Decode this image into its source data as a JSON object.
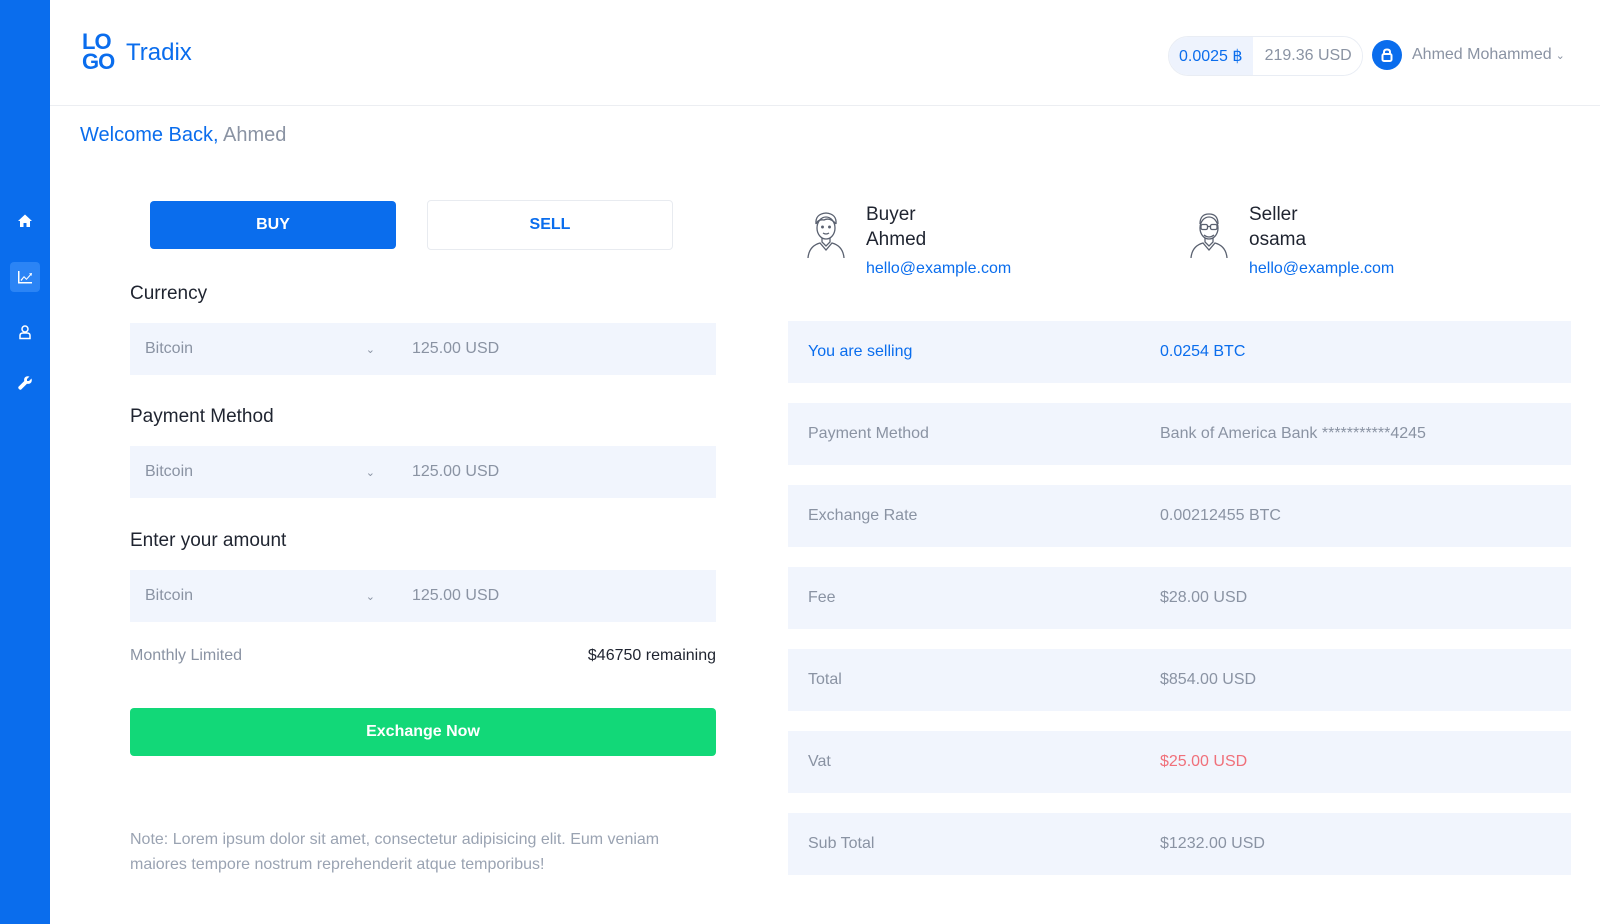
{
  "app": {
    "logo_mark_top": "LO",
    "logo_mark_bottom": "GO",
    "brand": "Tradix"
  },
  "header": {
    "btc_balance": "0.0025 ฿",
    "usd_balance": "219.36 USD",
    "user_name": "Ahmed Mohammed"
  },
  "sidebar": {
    "items": [
      {
        "icon": "home-icon"
      },
      {
        "icon": "chart-icon",
        "active": true
      },
      {
        "icon": "user-icon"
      },
      {
        "icon": "wrench-icon"
      }
    ]
  },
  "welcome": {
    "greeting": "Welcome Back, ",
    "name": "Ahmed"
  },
  "trade": {
    "buy_label": "BUY",
    "sell_label": "SELL",
    "fields": [
      {
        "label": "Currency",
        "select": "Bitcoin",
        "amount": "125.00 USD"
      },
      {
        "label": "Payment Method",
        "select": "Bitcoin",
        "amount": "125.00 USD"
      },
      {
        "label": "Enter your amount",
        "select": "Bitcoin",
        "amount": "125.00 USD"
      }
    ],
    "limit_label": "Monthly Limited",
    "limit_value": "$46750 remaining",
    "exchange_label": "Exchange Now",
    "note": "Note: Lorem ipsum dolor sit amet, consectetur adipisicing elit. Eum veniam maiores tempore nostrum reprehenderit atque temporibus!"
  },
  "buyer": {
    "role": "Buyer",
    "name": "Ahmed",
    "email": "hello@example.com"
  },
  "seller": {
    "role": "Seller",
    "name": "osama",
    "email": "hello@example.com"
  },
  "details": [
    {
      "key": "You are selling",
      "value": "0.0254 BTC"
    },
    {
      "key": "Payment Method",
      "value": "Bank of America Bank ***********4245"
    },
    {
      "key": "Exchange Rate",
      "value": "0.00212455 BTC"
    },
    {
      "key": "Fee",
      "value": "$28.00 USD"
    },
    {
      "key": "Total",
      "value": "$854.00 USD"
    },
    {
      "key": "Vat",
      "value": "$25.00 USD"
    },
    {
      "key": "Sub Total",
      "value": "$1232.00 USD"
    }
  ],
  "colors": {
    "primary": "#0a6ded",
    "success": "#12d878",
    "danger": "#f0707a",
    "row_bg": "#f1f5fd"
  }
}
